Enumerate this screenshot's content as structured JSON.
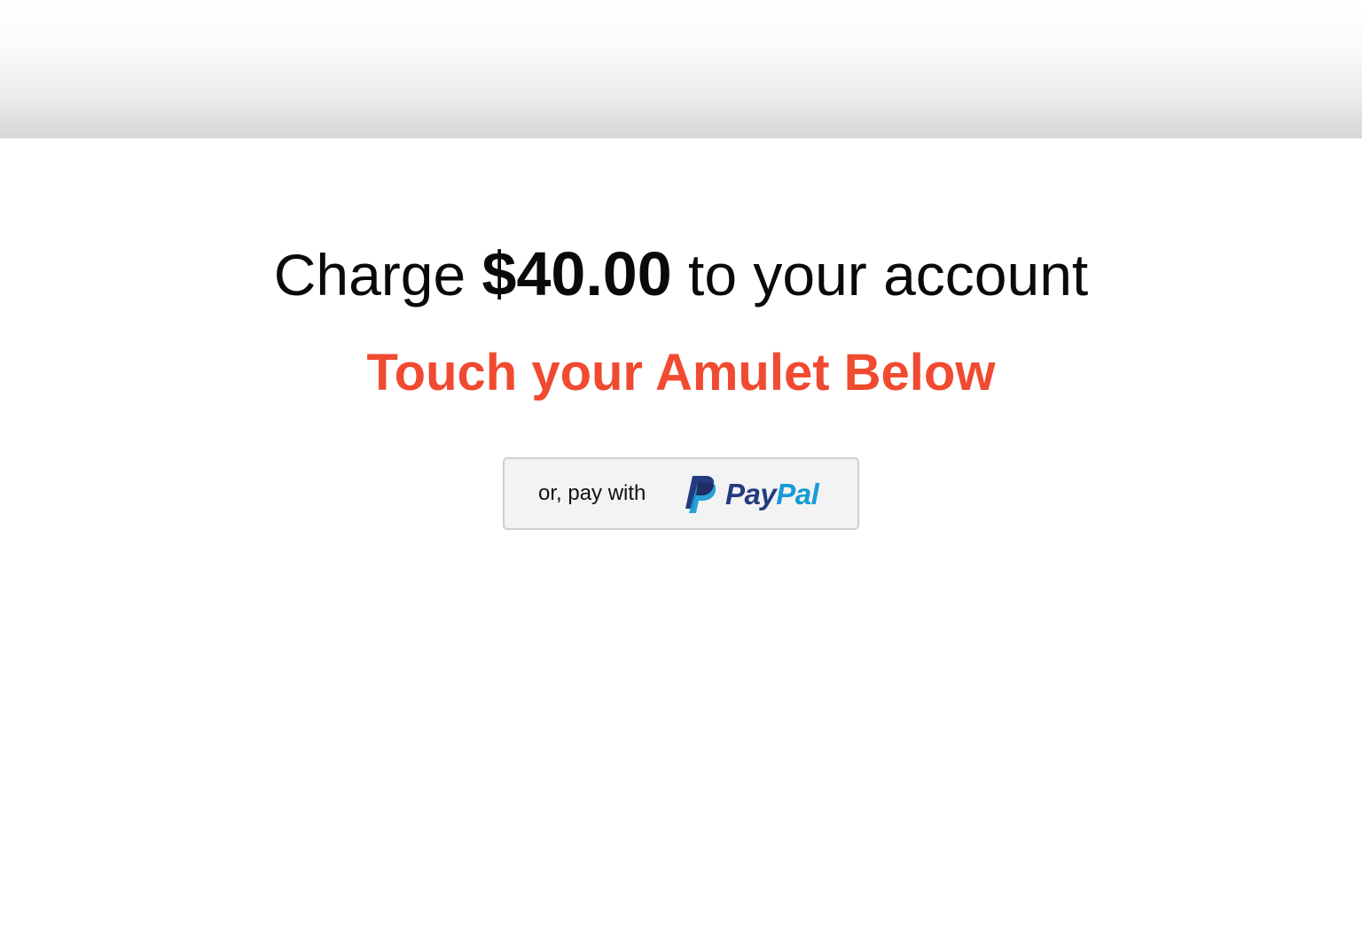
{
  "charge": {
    "prefix": "Charge",
    "amount": "$40.00",
    "suffix": "to your account"
  },
  "instruction": "Touch your Amulet Below",
  "paypal_button": {
    "label": "or, pay with",
    "brand_pay": "Pay",
    "brand_pal": "Pal",
    "icon": "paypal-logo-icon"
  },
  "colors": {
    "accent": "#f04a30",
    "paypal_dark_blue": "#253b80",
    "paypal_light_blue": "#179bd7",
    "button_background": "#f3f3f3",
    "button_border": "#cfcfcf"
  }
}
